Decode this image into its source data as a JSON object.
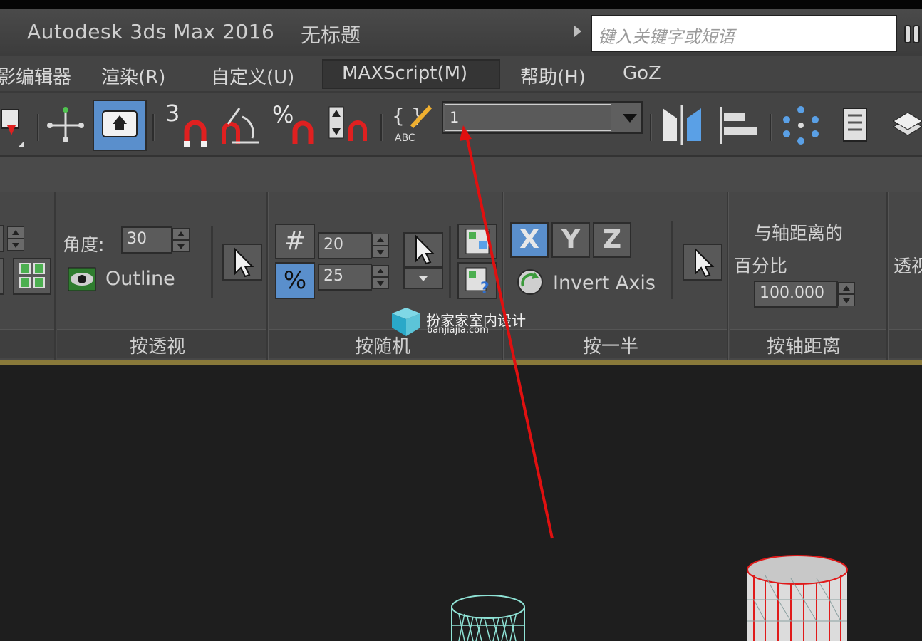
{
  "title_bar": {
    "app_title": "Autodesk 3ds Max 2016",
    "document_title": "无标题",
    "search_placeholder": "键入关键字或短语"
  },
  "menu": {
    "items": [
      {
        "label": "影编辑器"
      },
      {
        "label": "渲染(R)"
      },
      {
        "label": "自定义(U)"
      },
      {
        "label": "MAXScript(M)",
        "active": true
      },
      {
        "label": "帮助(H)"
      },
      {
        "label": "GoZ"
      }
    ]
  },
  "toolbar": {
    "snap_3d_label": "3",
    "percent_snap_label": "%",
    "named_selection_value": "1",
    "edit_named_label": "ABC",
    "active_color": "#5a8fcc"
  },
  "ribbon": {
    "perspective_panel": {
      "angle_label": "角度:",
      "angle_value": "30",
      "outline_label": "Outline",
      "footer": "按透视"
    },
    "random_panel": {
      "hash_symbol": "#",
      "hash_value": "20",
      "percent_symbol": "%",
      "percent_value": "25",
      "footer": "按随机"
    },
    "half_panel": {
      "axes": [
        "X",
        "Y",
        "Z"
      ],
      "active_axis": "X",
      "invert_axis_label": "Invert Axis",
      "footer": "按一半"
    },
    "distance_panel": {
      "label_line1": "与轴距离的",
      "label_line2": "百分比",
      "value": "100.000",
      "footer": "按轴距离"
    },
    "partial_panel": {
      "label": "透视"
    }
  },
  "watermark": {
    "text": "扮家家室内设计",
    "url": "banjiajia.com"
  },
  "colors": {
    "accent_blue": "#5a8fcc",
    "annotation_red": "#e01010",
    "viewport_bg": "#1e1e1e"
  }
}
